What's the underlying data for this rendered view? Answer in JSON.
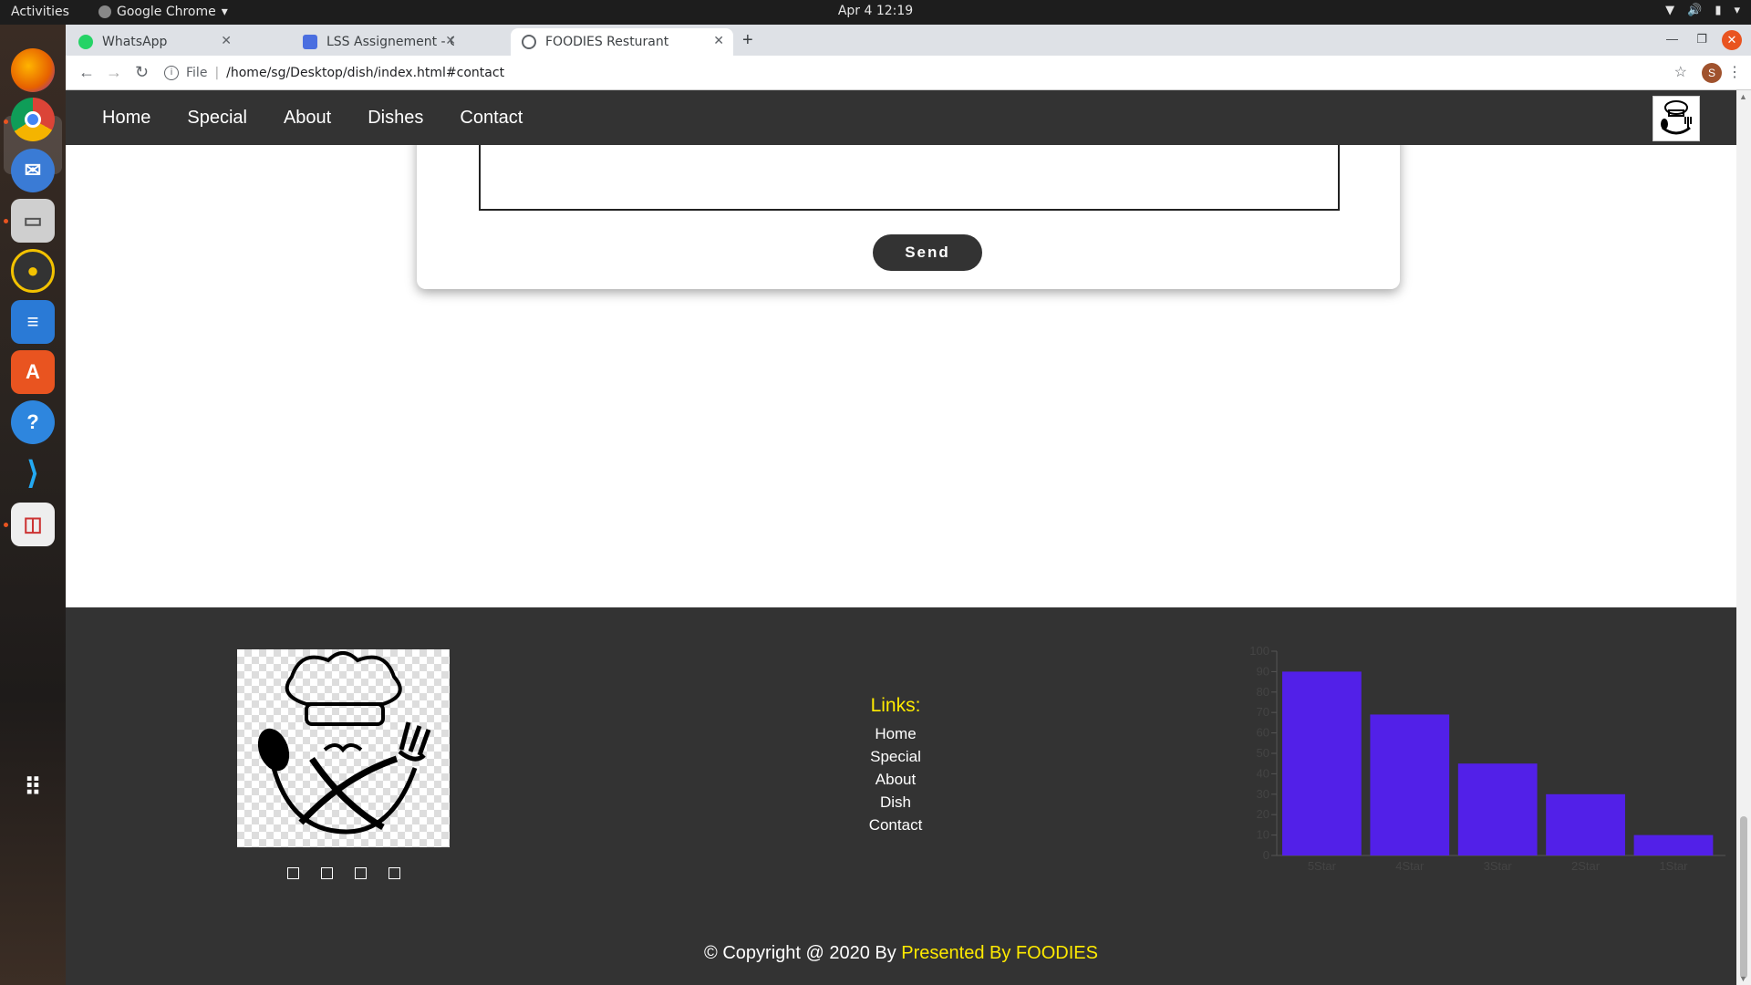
{
  "system_bar": {
    "activities": "Activities",
    "app_name": "Google Chrome",
    "clock": "Apr 4  12:19"
  },
  "browser": {
    "tabs": [
      {
        "title": "WhatsApp",
        "icon": "whatsapp-icon",
        "icon_color": "#25d366"
      },
      {
        "title": "LSS Assignement - Google",
        "icon": "docs-icon",
        "icon_color": "#4a6ee0"
      },
      {
        "title": "FOODIES Resturant",
        "icon": "globe-icon",
        "icon_color": "#5f6368"
      }
    ],
    "url_scheme": "File",
    "url": "/home/sg/Desktop/dish/index.html#contact",
    "profile_initial": "S"
  },
  "site": {
    "nav": [
      "Home",
      "Special",
      "About",
      "Dishes",
      "Contact"
    ],
    "contact": {
      "send_label": "Send"
    },
    "footer": {
      "links_heading": "Links:",
      "links": [
        "Home",
        "Special",
        "About",
        "Dish",
        "Contact"
      ],
      "copyright_prefix": "© Copyright @ 2020 By ",
      "copyright_brand": "Presented By FOODIES"
    },
    "colors": {
      "nav_bg": "#333333",
      "footer_bg": "#333333",
      "accent_yellow": "#ffea00",
      "bar_color": "#5220e8"
    }
  },
  "chart_data": {
    "type": "bar",
    "categories": [
      "5Star",
      "4Star",
      "3Star",
      "2Star",
      "1Star"
    ],
    "values": [
      90,
      69,
      45,
      30,
      10
    ],
    "ylim": [
      0,
      100
    ],
    "yticks": [
      0,
      10,
      20,
      30,
      40,
      50,
      60,
      70,
      80,
      90,
      100
    ],
    "title": "",
    "xlabel": "",
    "ylabel": ""
  }
}
